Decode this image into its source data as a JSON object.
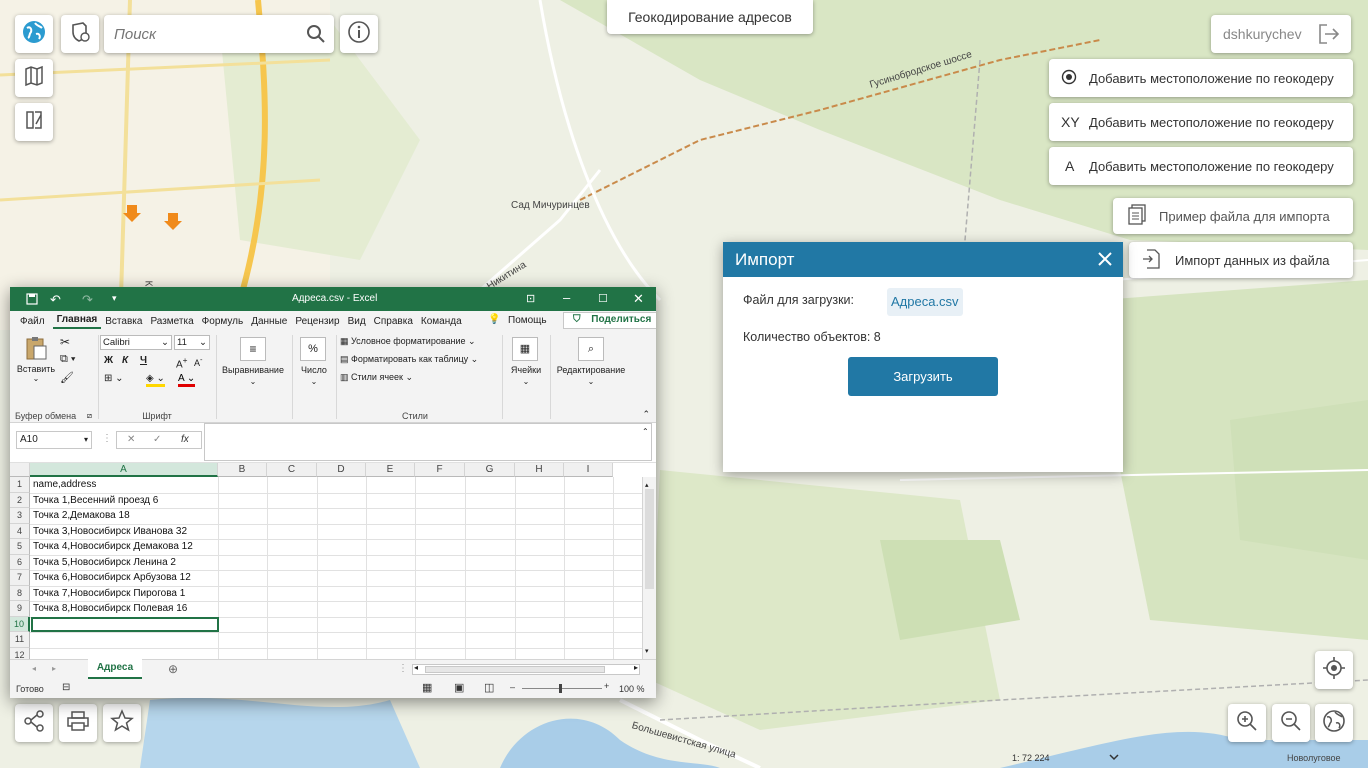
{
  "map": {
    "search_placeholder": "Поиск",
    "title_button": "Геокодирование адресов",
    "user": "dshkurychev",
    "geocode_buttons": [
      {
        "icon": "circle-dot-icon",
        "glyph": "",
        "label": "Добавить местоположение по геокодеру"
      },
      {
        "icon": "xy-icon",
        "glyph": "XY",
        "label": "Добавить местоположение по геокодеру"
      },
      {
        "icon": "letter-a-icon",
        "glyph": "A",
        "label": "Добавить местоположение по геокодеру"
      }
    ],
    "sample_file_button": "Пример файла для импорта",
    "import_file_button": "Импорт данных из файла",
    "labels": {
      "sad": "Сад Мичуринцев",
      "shosse": "Гусинобродское шоссе",
      "nikitina": "Никитина",
      "bolsh": "Большевистская улица",
      "kra": "Кра",
      "novolugovoe": "Новолуговое"
    },
    "scale": "1: 72 224"
  },
  "excel": {
    "title": "Адреса.csv - Excel",
    "tabs": [
      "Файл",
      "Главная",
      "Вставка",
      "Разметка",
      "Формуль",
      "Данные",
      "Рецензир",
      "Вид",
      "Справка",
      "Команда"
    ],
    "help": "Помощь",
    "share": "Поделиться",
    "ribbon": {
      "paste": "Вставить",
      "clipboard": "Буфер обмена",
      "font_name": "Calibri",
      "font_size": "11",
      "font_group": "Шрифт",
      "bold": "Ж",
      "italic": "К",
      "underline": "Ч",
      "align": "Выравнивание",
      "number": "Число",
      "cond_format": "Условное форматирование",
      "format_table": "Форматировать как таблицу",
      "cell_styles": "Стили ячеек",
      "styles_group": "Стили",
      "cells": "Ячейки",
      "editing": "Редактирование"
    },
    "name_box": "A10",
    "fx": "fx",
    "columns": [
      "A",
      "B",
      "C",
      "D",
      "E",
      "F",
      "G",
      "H",
      "I"
    ],
    "rows": [
      {
        "n": "1",
        "v": "name,address"
      },
      {
        "n": "2",
        "v": "Точка 1,Весенний проезд 6"
      },
      {
        "n": "3",
        "v": "Точка 2,Демакова 18"
      },
      {
        "n": "4",
        "v": "Точка 3,Новосибирск Иванова 32"
      },
      {
        "n": "5",
        "v": "Точка 4,Новосибирск Демакова 12"
      },
      {
        "n": "6",
        "v": "Точка 5,Новосибирск Ленина 2"
      },
      {
        "n": "7",
        "v": "Точка 6,Новосибирск Арбузова 12"
      },
      {
        "n": "8",
        "v": "Точка 7,Новосибирск Пирогова 1"
      },
      {
        "n": "9",
        "v": "Точка 8,Новосибирск Полевая 16"
      },
      {
        "n": "10",
        "v": ""
      },
      {
        "n": "11",
        "v": ""
      },
      {
        "n": "12",
        "v": ""
      }
    ],
    "sheet_tab": "Адреса",
    "status": "Готово",
    "zoom": "100 %"
  },
  "dialog": {
    "title": "Импорт",
    "file_label": "Файл для загрузки:",
    "file_name": "Адреса.csv",
    "count_label": "Количество объектов: 8",
    "upload_button": "Загрузить"
  },
  "colors": {
    "accent": "#2178a5",
    "excel": "#217346"
  }
}
